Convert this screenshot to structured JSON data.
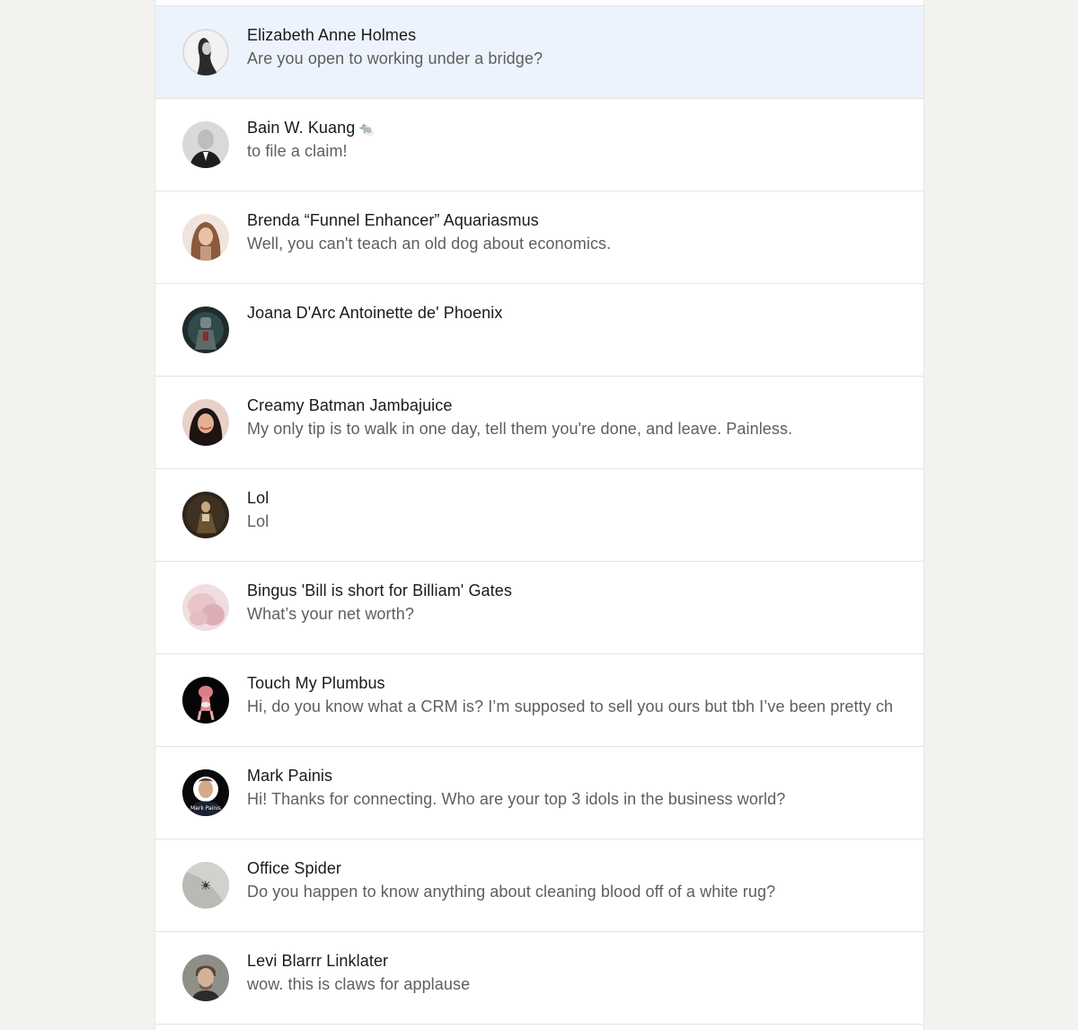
{
  "conversations": [
    {
      "name": "Elizabeth Anne Holmes",
      "snippet": "Are you open to working under a bridge?"
    },
    {
      "name": "Bain W. Kuang",
      "emoji": "🐀",
      "snippet": "to file a claim!"
    },
    {
      "name": "Brenda “Funnel Enhancer” Aquariasmus",
      "snippet": "Well, you can't teach an old dog about economics."
    },
    {
      "name": "Joana D'Arc Antoinette de' Phoenix",
      "snippet": ""
    },
    {
      "name": "Creamy Batman Jambajuice",
      "snippet": "My only tip is to walk in one day, tell them you're done, and leave. Painless."
    },
    {
      "name": "Lol",
      "snippet": "Lol"
    },
    {
      "name": "Bingus 'Bill is short for Billiam' Gates",
      "snippet": "What’s your net worth?"
    },
    {
      "name": "Touch My Plumbus",
      "snippet": "Hi, do you know what a CRM is? I’m supposed to sell you ours but tbh I’ve been pretty ch"
    },
    {
      "name": "Mark Painis",
      "snippet": "Hi! Thanks for connecting. Who are your top 3 idols in the business world?",
      "avatar_caption": "Mark Painis"
    },
    {
      "name": "Office Spider",
      "snippet": "Do you happen to know anything about cleaning blood off of a white rug?"
    },
    {
      "name": "Levi Blarrr Linklater",
      "snippet": "wow. this is claws for applause"
    }
  ],
  "active_index": 0,
  "colors": {
    "page_bg": "#f3f2ef",
    "panel_bg": "#ffffff",
    "active_bg": "#edf3fd",
    "divider": "#e3e3e3",
    "name_text": "#1a1a1a",
    "snippet_text": "#5e5e5e"
  }
}
